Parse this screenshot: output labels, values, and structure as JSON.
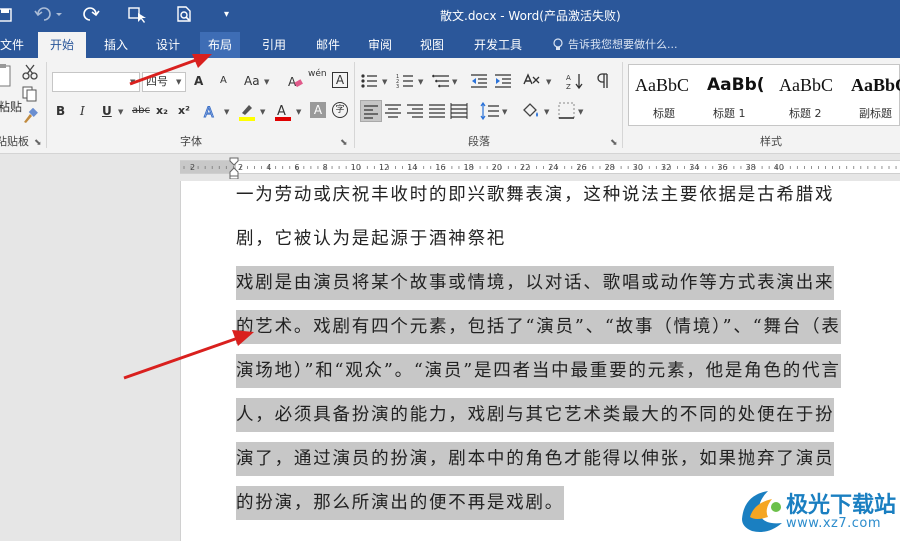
{
  "titlebar": {
    "title": "散文.docx - Word(产品激活失败)",
    "save_icon": "save-icon",
    "undo_icon": "undo-icon",
    "redo_icon": "redo-icon",
    "touch_icon": "touch-mode-icon",
    "preview_icon": "print-preview-icon",
    "customize_icon": "customize-quick-access-icon"
  },
  "tabs": [
    "文件",
    "开始",
    "插入",
    "设计",
    "布局",
    "引用",
    "邮件",
    "审阅",
    "视图",
    "开发工具"
  ],
  "active_tab": "开始",
  "highlighted_tab": "布局",
  "tell_me": "告诉我您想要做什么...",
  "ribbon": {
    "clipboard_label": "粘贴板",
    "paste_label": "粘贴",
    "font_label": "字体",
    "font_name": "",
    "font_size": "四号",
    "paragraph_label": "段落",
    "styles_label": "样式",
    "grow_font": "A",
    "shrink_font": "A",
    "change_case": "Aa",
    "bold": "B",
    "italic": "I",
    "underline": "U",
    "strike": "abc",
    "subscript": "x₂",
    "superscript": "x²",
    "phonetic": "wén",
    "border_char": "A",
    "shading_char": "A",
    "circle_char": "字",
    "styles": [
      {
        "preview": "AaBbC",
        "name": "标题"
      },
      {
        "preview": "AaBb(",
        "name": "标题 1"
      },
      {
        "preview": "AaBbC",
        "name": "标题 2"
      },
      {
        "preview": "AaBbC",
        "name": "副标题"
      }
    ]
  },
  "ruler": {
    "numbers": [
      "2",
      "2",
      "4",
      "6",
      "8",
      "10",
      "12",
      "14",
      "16",
      "18",
      "20",
      "22",
      "24",
      "26",
      "28",
      "30",
      "32",
      "34",
      "36",
      "38",
      "40"
    ]
  },
  "document": {
    "lines": [
      {
        "text": "一为劳动或庆祝丰收时的即兴歌舞表演，这种说法主要依据是古希腊戏",
        "selected": false
      },
      {
        "text": "剧，它被认为是起源于酒神祭祀",
        "selected": false
      },
      {
        "text": "戏剧是由演员将某个故事或情境，以对话、歌唱或动作等方式表演出来",
        "selected": true
      },
      {
        "text": "的艺术。戏剧有四个元素，包括了“演员”、“故事（情境）”、“舞台（表",
        "selected": true
      },
      {
        "text": "演场地）”和“观众”。“演员”是四者当中最重要的元素，他是角色的代言",
        "selected": true
      },
      {
        "text": "人，必须具备扮演的能力，戏剧与其它艺术类最大的不同的处便在于扮",
        "selected": true
      },
      {
        "text": "演了，通过演员的扮演，剧本中的角色才能得以伸张，如果抛弃了演员",
        "selected": true
      },
      {
        "text": "的扮演，那么所演出的便不再是戏剧。",
        "selected": true
      }
    ]
  },
  "watermark": {
    "title": "极光下载站",
    "url": "www.xz7.com"
  },
  "colors": {
    "word_blue": "#2b579a",
    "arrow_red": "#d9201e",
    "selection_grey": "#c7c7c7",
    "highlight_yellow": "#ffff00",
    "font_red": "#e00000"
  }
}
